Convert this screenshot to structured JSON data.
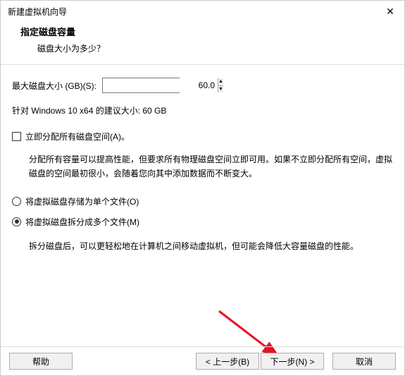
{
  "window": {
    "title": "新建虚拟机向导"
  },
  "header": {
    "title": "指定磁盘容量",
    "subtitle": "磁盘大小为多少？"
  },
  "disk": {
    "size_label": "最大磁盘大小 (GB)(S):",
    "size_value": "60.0",
    "recommend": "针对 Windows 10 x64 的建议大小: 60 GB"
  },
  "allocate": {
    "checkbox_label": "立即分配所有磁盘空间(A)。",
    "desc": "分配所有容量可以提高性能，但要求所有物理磁盘空间立即可用。如果不立即分配所有空间，虚拟磁盘的空间最初很小，会随着您向其中添加数据而不断变大。"
  },
  "store": {
    "single_label": "将虚拟磁盘存储为单个文件(O)",
    "split_label": "将虚拟磁盘拆分成多个文件(M)",
    "split_desc": "拆分磁盘后，可以更轻松地在计算机之间移动虚拟机，但可能会降低大容量磁盘的性能。"
  },
  "buttons": {
    "help": "帮助",
    "back": "< 上一步(B)",
    "next": "下一步(N) >",
    "cancel": "取消"
  }
}
